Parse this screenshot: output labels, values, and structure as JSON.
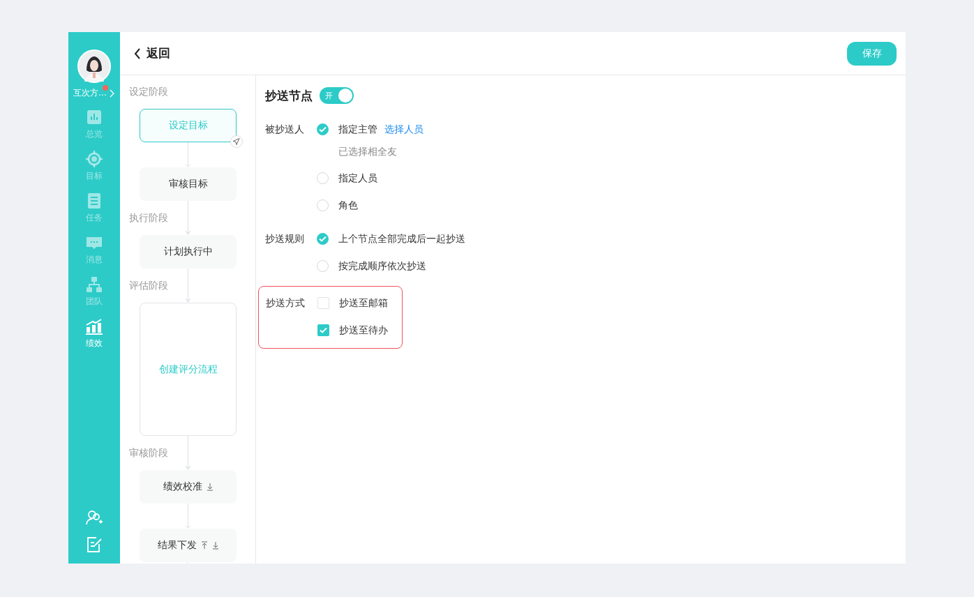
{
  "sidebar": {
    "user": {
      "name": "互次方…",
      "has_notification": true
    },
    "items": [
      {
        "label": "总览",
        "selected": false
      },
      {
        "label": "目标",
        "selected": false
      },
      {
        "label": "任务",
        "selected": false
      },
      {
        "label": "消息",
        "selected": false
      },
      {
        "label": "团队",
        "selected": false
      },
      {
        "label": "绩效",
        "selected": true
      }
    ]
  },
  "header": {
    "back": "返回",
    "save": "保存"
  },
  "flow": [
    {
      "stage": "设定阶段",
      "nodes": [
        {
          "label": "设定目标",
          "kind": "step",
          "selected": true,
          "move_up": false,
          "move_down": false
        },
        {
          "label": "审核目标",
          "kind": "step",
          "selected": false,
          "move_up": false,
          "move_down": false
        }
      ]
    },
    {
      "stage": "执行阶段",
      "nodes": [
        {
          "label": "计划执行中",
          "kind": "step",
          "selected": false,
          "move_up": false,
          "move_down": false
        }
      ]
    },
    {
      "stage": "评估阶段",
      "nodes": [
        {
          "label": "创建评分流程",
          "kind": "create",
          "selected": false,
          "move_up": false,
          "move_down": false
        }
      ]
    },
    {
      "stage": "审核阶段",
      "nodes": [
        {
          "label": "绩效校准",
          "kind": "step",
          "selected": false,
          "move_up": false,
          "move_down": true
        },
        {
          "label": "结果下发",
          "kind": "step",
          "selected": false,
          "move_up": true,
          "move_down": true
        }
      ]
    }
  ],
  "settings": {
    "title": "抄送节点",
    "switch": {
      "label": "开",
      "on": true
    },
    "sections": [
      {
        "label": "被抄送人",
        "kind": "radio",
        "highlighted": false,
        "options": [
          {
            "label": "指定主管",
            "selected": true,
            "link": "选择人员",
            "note": "已选择相全友"
          },
          {
            "label": "指定人员",
            "selected": false
          },
          {
            "label": "角色",
            "selected": false
          }
        ]
      },
      {
        "label": "抄送规则",
        "kind": "radio",
        "highlighted": false,
        "options": [
          {
            "label": "上个节点全部完成后一起抄送",
            "selected": true
          },
          {
            "label": "按完成顺序依次抄送",
            "selected": false
          }
        ]
      },
      {
        "label": "抄送方式",
        "kind": "checkbox",
        "highlighted": true,
        "options": [
          {
            "label": "抄送至邮箱",
            "checked": false
          },
          {
            "label": "抄送至待办",
            "checked": true
          }
        ]
      }
    ]
  }
}
